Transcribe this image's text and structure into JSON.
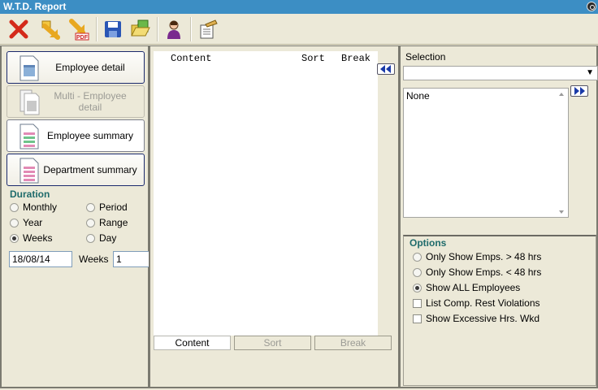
{
  "window": {
    "title": "W.T.D. Report"
  },
  "toolbar": {
    "buttons": [
      {
        "name": "close-report-icon"
      },
      {
        "name": "export-icon"
      },
      {
        "name": "export-pdf-icon",
        "badge": "PDF"
      },
      {
        "name": "save-icon"
      },
      {
        "name": "open-folder-icon"
      },
      {
        "name": "user-icon"
      },
      {
        "name": "properties-icon"
      }
    ]
  },
  "reports": [
    {
      "label": "Employee detail",
      "state": "selected"
    },
    {
      "label": "Multi - Employee detail",
      "state": "disabled"
    },
    {
      "label": "Employee summary",
      "state": "normal"
    },
    {
      "label": "Department summary",
      "state": "selected"
    }
  ],
  "duration": {
    "title": "Duration",
    "options": [
      {
        "label": "Monthly",
        "checked": false
      },
      {
        "label": "Period",
        "checked": false
      },
      {
        "label": "Year",
        "checked": false
      },
      {
        "label": "Range",
        "checked": false
      },
      {
        "label": "Weeks",
        "checked": true
      },
      {
        "label": "Day",
        "checked": false
      }
    ],
    "date_value": "18/08/14",
    "weeks_label": "Weeks",
    "weeks_value": "1"
  },
  "columns": {
    "headers": {
      "content": "Content",
      "sort": "Sort",
      "break": "Break"
    },
    "tabs": {
      "content": "Content",
      "sort": "Sort",
      "break": "Break"
    }
  },
  "selection": {
    "label": "Selection",
    "dropdown_value": "",
    "items": [
      "None"
    ]
  },
  "options": {
    "title": "Options",
    "radios": [
      {
        "label": "Only Show Emps. > 48 hrs",
        "checked": false
      },
      {
        "label": "Only Show Emps. < 48 hrs",
        "checked": false
      },
      {
        "label": "Show ALL Employees",
        "checked": true
      }
    ],
    "checks": [
      {
        "label": "List Comp. Rest Violations",
        "checked": false
      },
      {
        "label": "Show Excessive Hrs. Wkd",
        "checked": false
      }
    ]
  }
}
